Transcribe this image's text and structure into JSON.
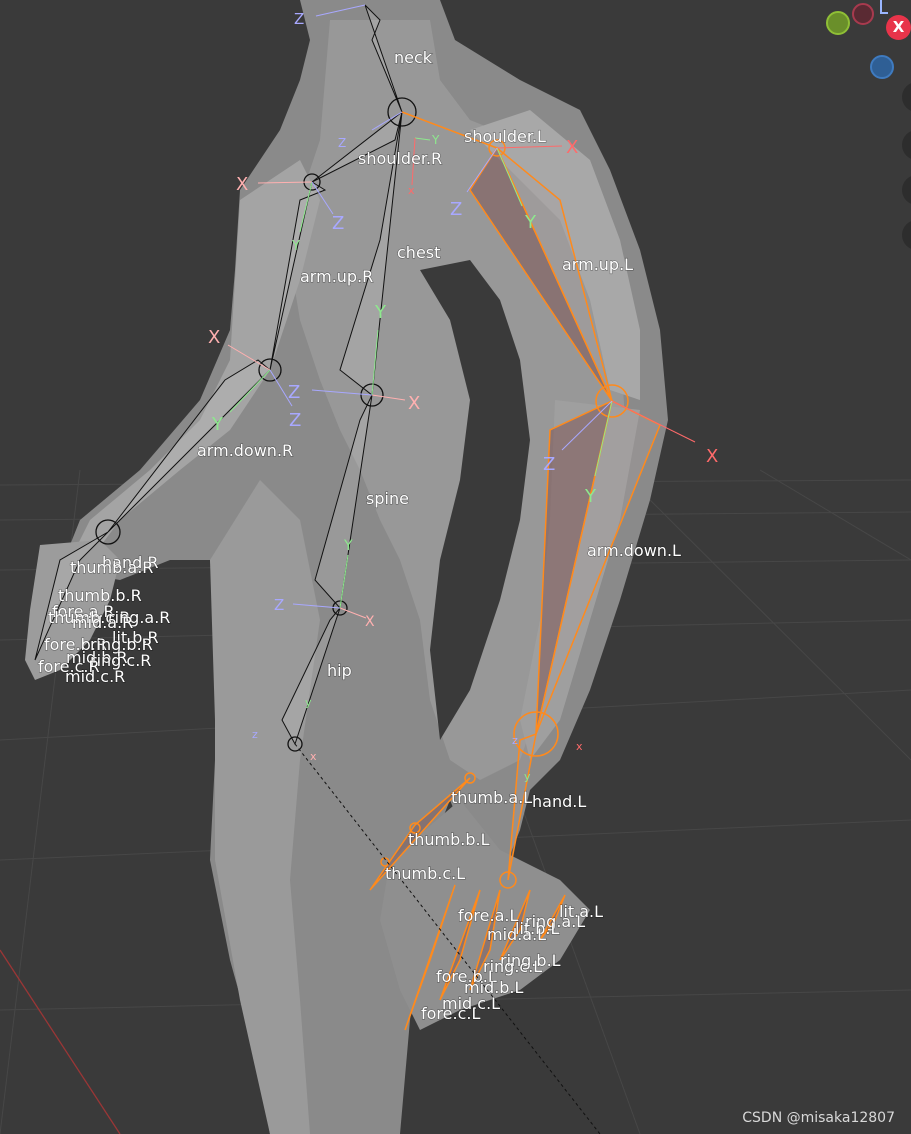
{
  "bones_left_side": {
    "neck": "neck",
    "shoulder_r": "shoulder.R",
    "shoulder_l": "shoulder.L",
    "chest": "chest",
    "arm_up_r": "arm.up.R",
    "arm_up_l": "arm.up.L",
    "arm_down_r": "arm.down.R",
    "arm_down_l": "arm.down.L",
    "spine": "spine",
    "hip": "hip",
    "hand_r": "hand.R",
    "hand_l": "hand.L"
  },
  "right_hand_labels": {
    "thumb_a": "thumb.a.R",
    "thumb_b": "thumb.b.R",
    "thumb_c": "thumb.c.R",
    "fore_a": "fore.a.R",
    "mid_a": "mid.a.R",
    "ring_a": "ring.a.R",
    "lit_b": "lit.b.R",
    "ring_b": "ring.b.R",
    "fore_b": "fore.b.R",
    "mid_b": "mid.b.R",
    "ring_c": "ring.c.R",
    "fore_c": "fore.c.R",
    "mid_c": "mid.c.R"
  },
  "left_hand_labels": {
    "thumb_a": "thumb.a.L",
    "thumb_b": "thumb.b.L",
    "thumb_c": "thumb.c.L",
    "fore_a": "fore.a.L",
    "ring_a": "ring.a.L",
    "lit_a": "lit.a.L",
    "mid_a": "mid.a.L",
    "lit_b": "lit.b.L",
    "ring_b": "ring.b.L",
    "fore_b": "fore.b.L",
    "ring_c": "ring.c.L",
    "mid_b": "mid.b.L",
    "mid_c": "mid.c.L",
    "fore_c": "fore.c.L"
  },
  "axes": {
    "x": "X",
    "y": "Y",
    "z": "Z",
    "x_lower": "x",
    "y_lower": "y",
    "z_lower": "z"
  },
  "gizmo": {
    "close_label": "X",
    "colors": {
      "green": "#6a8f2a",
      "red": "#8a2a3a",
      "close": "#e8344a",
      "blue": "#2f5f95"
    }
  },
  "colors": {
    "selected": "#ff8a1c",
    "axis_x": "#ff6a6a",
    "axis_y": "#8ee88e",
    "axis_z": "#a8a8ff"
  },
  "watermark": "CSDN @misaka12807"
}
